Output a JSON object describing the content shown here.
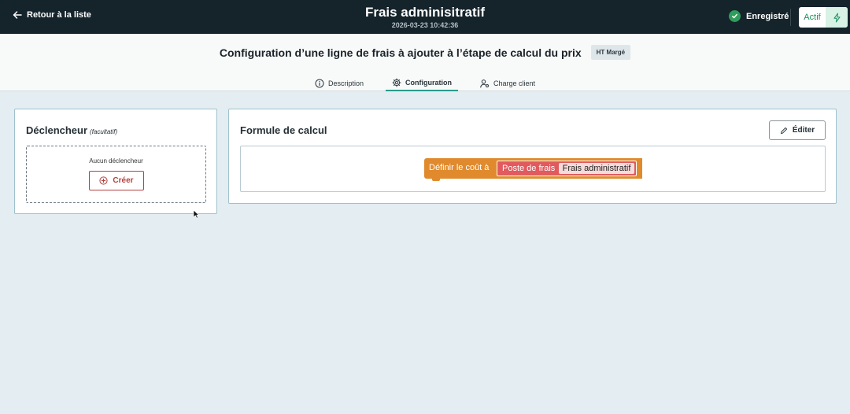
{
  "topbar": {
    "back_label": "Retour à la liste",
    "title": "Frais adminisitratif",
    "timestamp": "2026-03-23 10:42:36",
    "status_label": "Enregistré",
    "active_label": "Actif",
    "background_color": "#15232b"
  },
  "header": {
    "heading": "Configuration d’une ligne de frais à ajouter à l’étape de calcul du prix",
    "badge": "HT Margé",
    "tabs": [
      {
        "label": "Description",
        "icon": "info-icon",
        "active": false
      },
      {
        "label": "Configuration",
        "icon": "gear-icon",
        "active": true
      },
      {
        "label": "Charge client",
        "icon": "user-settings-icon",
        "active": false
      }
    ]
  },
  "trigger_card": {
    "title": "Déclencheur",
    "optional": "(facultatif)",
    "empty_text": "Aucun déclencheur",
    "create_label": "Créer"
  },
  "formula_card": {
    "title": "Formule de calcul",
    "edit_label": "Éditer",
    "block": {
      "label": "Définir le coût à",
      "inner_label": "Poste de frais",
      "field_value": "Frais administratif"
    }
  },
  "colors": {
    "accent": "#2b9a8c",
    "success": "#2f9d5b",
    "danger": "#b2423f",
    "block_orange": "#e08a2d",
    "block_red": "#e05a5e"
  }
}
